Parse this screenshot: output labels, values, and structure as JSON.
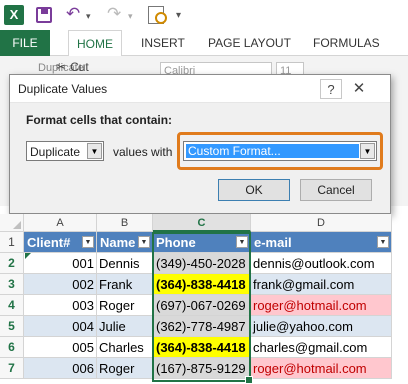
{
  "app": {
    "logo_letter": "X"
  },
  "qat": {
    "undo_icon": "↶",
    "redo_icon": "↷",
    "dropdown_icon": "▾"
  },
  "tabs": [
    "FILE",
    "HOME",
    "INSERT",
    "PAGE LAYOUT",
    "FORMULAS"
  ],
  "ribbon": {
    "cut_label": "Cut",
    "cut_icon": "✂",
    "duplicate_label": "Duplicate",
    "font_name": "Calibri",
    "font_size": "11"
  },
  "dialog": {
    "title": "Duplicate Values",
    "help_label": "?",
    "close_label": "✕",
    "prompt": "Format cells that contain:",
    "type_value": "Duplicate",
    "values_with_label": "values with",
    "format_value": "Custom Format...",
    "ok_label": "OK",
    "cancel_label": "Cancel"
  },
  "sheet": {
    "columns": [
      "A",
      "B",
      "C",
      "D"
    ],
    "selected_column": "C",
    "row_numbers": [
      "1",
      "2",
      "3",
      "4",
      "5",
      "6",
      "7"
    ],
    "headers": [
      "Client#",
      "Name",
      "Phone",
      "e-mail"
    ],
    "rows": [
      {
        "client": "001",
        "name": "Dennis",
        "phone": "(349)-450-2028",
        "email": "dennis@outlook.com",
        "phone_dup": false,
        "email_dup": false
      },
      {
        "client": "002",
        "name": "Frank",
        "phone": "(364)-838-4418",
        "email": "frank@gmail.com",
        "phone_dup": true,
        "email_dup": false
      },
      {
        "client": "003",
        "name": "Roger",
        "phone": "(697)-067-0269",
        "email": "roger@hotmail.com",
        "phone_dup": false,
        "email_dup": true
      },
      {
        "client": "004",
        "name": "Julie",
        "phone": "(362)-778-4987",
        "email": "julie@yahoo.com",
        "phone_dup": false,
        "email_dup": false
      },
      {
        "client": "005",
        "name": "Charles",
        "phone": "(364)-838-4418",
        "email": "charles@gmail.com",
        "phone_dup": true,
        "email_dup": false
      },
      {
        "client": "006",
        "name": "Roger",
        "phone": "(167)-875-9129",
        "email": "roger@hotmail.com",
        "phone_dup": false,
        "email_dup": true
      }
    ]
  },
  "colors": {
    "excel_green": "#217346",
    "dup_highlight": "#ffff00",
    "dup_red_fill": "#ffc7ce",
    "dup_red_text": "#c00000",
    "header_blue": "#4f81bd",
    "band_blue": "#dce6f1",
    "dialog_accent": "#e07b1c"
  }
}
